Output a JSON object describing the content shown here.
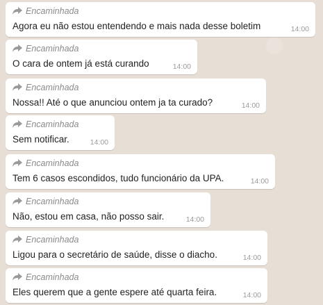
{
  "messages": [
    {
      "label": "Encaminhada",
      "text": "Agora eu não estou entendendo e mais nada desse boletim",
      "time": "14:00"
    },
    {
      "label": "Encaminhada",
      "text": "O cara de ontem já está curando",
      "time": "14:00"
    },
    {
      "label": "Encaminhada",
      "text": "Nossa!! Até o que anunciou ontem ja ta curado?",
      "time": "14:00"
    },
    {
      "label": "Encaminhada",
      "text": "Sem notificar.",
      "time": "14:00"
    },
    {
      "label": "Encaminhada",
      "text": "Tem 6 casos escondidos, tudo funcionário da UPA.",
      "time": "14:00"
    },
    {
      "label": "Encaminhada",
      "text": "Não, estou em casa, não posso sair.",
      "time": "14:00"
    },
    {
      "label": "Encaminhada",
      "text": "Ligou para o secretário de saúde, disse o diacho.",
      "time": "14:00"
    },
    {
      "label": "Encaminhada",
      "text": "Eles querem que a gente espere até quarta feira.",
      "time": "14:00"
    }
  ],
  "icons": {
    "forward": "forwarded-arrow-icon"
  },
  "colors": {
    "background": "#e7ded6",
    "bubble": "#ffffff",
    "meta_text": "#8a8a8a",
    "message_text": "#1f1f1f"
  }
}
